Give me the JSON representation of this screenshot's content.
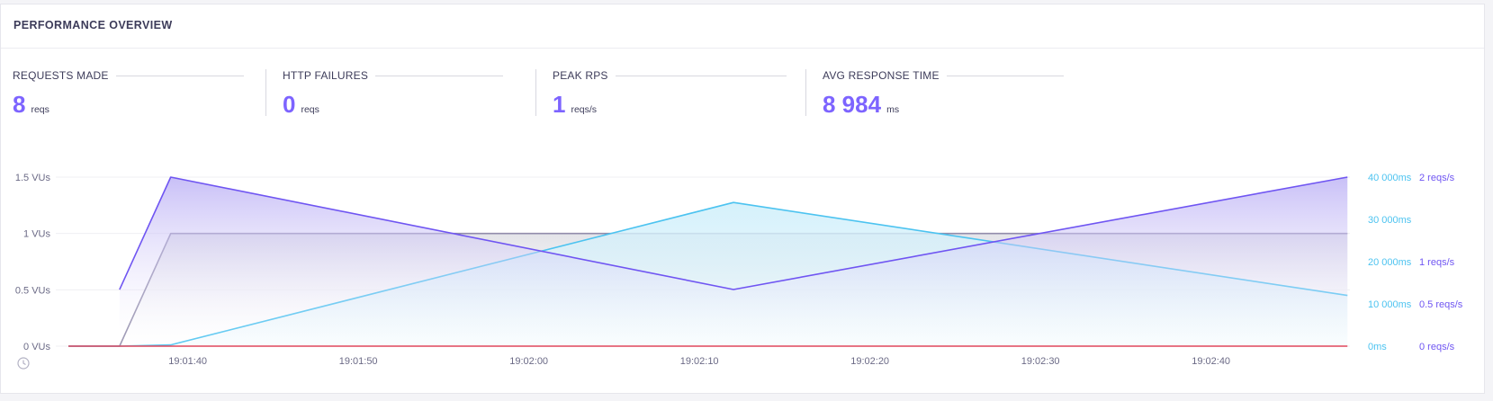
{
  "panel": {
    "title": "PERFORMANCE OVERVIEW"
  },
  "stats": [
    {
      "label": "REQUESTS MADE",
      "value": "8",
      "unit": "reqs"
    },
    {
      "label": "HTTP FAILURES",
      "value": "0",
      "unit": "reqs"
    },
    {
      "label": "PEAK RPS",
      "value": "1",
      "unit": "reqs/s"
    },
    {
      "label": "AVG RESPONSE TIME",
      "value": "8 984",
      "unit": "ms"
    }
  ],
  "colors": {
    "accent": "#7d64ff",
    "vus": "#918cab",
    "response_time": "#4cc3f0",
    "rps": "#6f55f2",
    "failures": "#e0475c"
  },
  "icons": {
    "time_axis": "clock-icon"
  },
  "chart_data": {
    "type": "line",
    "x": [
      "19:01:33",
      "19:01:36",
      "19:01:39",
      "19:02:12",
      "19:02:48"
    ],
    "x_tick_labels": [
      "19:01:40",
      "19:01:50",
      "19:02:00",
      "19:02:10",
      "19:02:20",
      "19:02:30",
      "19:02:40"
    ],
    "series": [
      {
        "axis": "vus",
        "values": [
          0,
          0,
          1,
          1,
          1
        ]
      },
      {
        "axis": "response_time",
        "values": [
          0,
          0,
          300,
          34000,
          12000
        ]
      },
      {
        "axis": "rps",
        "values": [
          null,
          0.67,
          2,
          0.67,
          2
        ]
      },
      {
        "axis": "rps_failed",
        "values": [
          0,
          0,
          0,
          0,
          0
        ]
      }
    ],
    "axes": {
      "vus": {
        "range": [
          0,
          1.5
        ],
        "ticks": [
          "0 VUs",
          "0.5 VUs",
          "1 VUs",
          "1.5 VUs"
        ]
      },
      "response_time": {
        "range": [
          0,
          40000
        ],
        "ticks": [
          "0ms",
          "10 000ms",
          "20 000ms",
          "30 000ms",
          "40 000ms"
        ]
      },
      "rps": {
        "range": [
          0,
          2
        ],
        "ticks": [
          "0 reqs/s",
          "0.5 reqs/s",
          "1 reqs/s",
          "2 reqs/s"
        ]
      }
    },
    "grid": true
  }
}
